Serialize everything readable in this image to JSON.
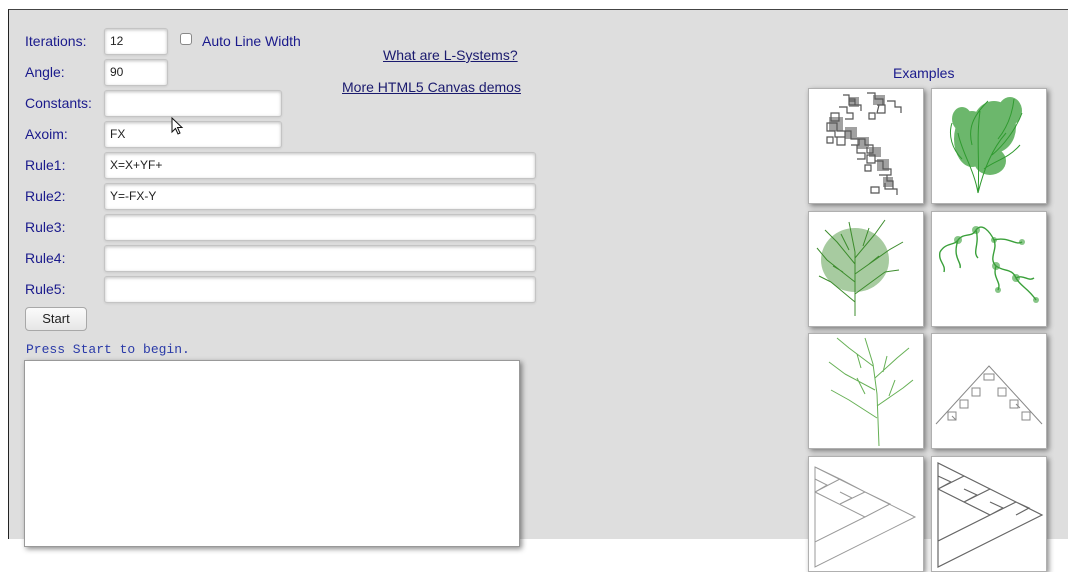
{
  "form": {
    "iterations_label": "Iterations:",
    "iterations_value": "12",
    "auto_line_width_label": "Auto Line Width",
    "angle_label": "Angle:",
    "angle_value": "90",
    "constants_label": "Constants:",
    "constants_value": "",
    "axiom_label": "Axoim:",
    "axiom_value": "FX",
    "rule1_label": "Rule1:",
    "rule1_value": "X=X+YF+",
    "rule2_label": "Rule2:",
    "rule2_value": "Y=-FX-Y",
    "rule3_label": "Rule3:",
    "rule3_value": "",
    "rule4_label": "Rule4:",
    "rule4_value": "",
    "rule5_label": "Rule5:",
    "rule5_value": "",
    "start_label": "Start"
  },
  "links": {
    "what_are": "What are L-Systems?",
    "more_demos": "More HTML5 Canvas demos"
  },
  "status": "Press Start to begin.",
  "examples": {
    "title": "Examples",
    "thumbnails": [
      {
        "name": "dragon-curve",
        "color": "#555555"
      },
      {
        "name": "bush-1",
        "color": "#2f9a2f"
      },
      {
        "name": "tree-1",
        "color": "#3c8c2c"
      },
      {
        "name": "vine",
        "color": "#3aa03a"
      },
      {
        "name": "tree-2",
        "color": "#66b055"
      },
      {
        "name": "sierpinski-carpet",
        "color": "#888888"
      },
      {
        "name": "sierpinski-1",
        "color": "#999999"
      },
      {
        "name": "sierpinski-2",
        "color": "#666666"
      }
    ]
  }
}
